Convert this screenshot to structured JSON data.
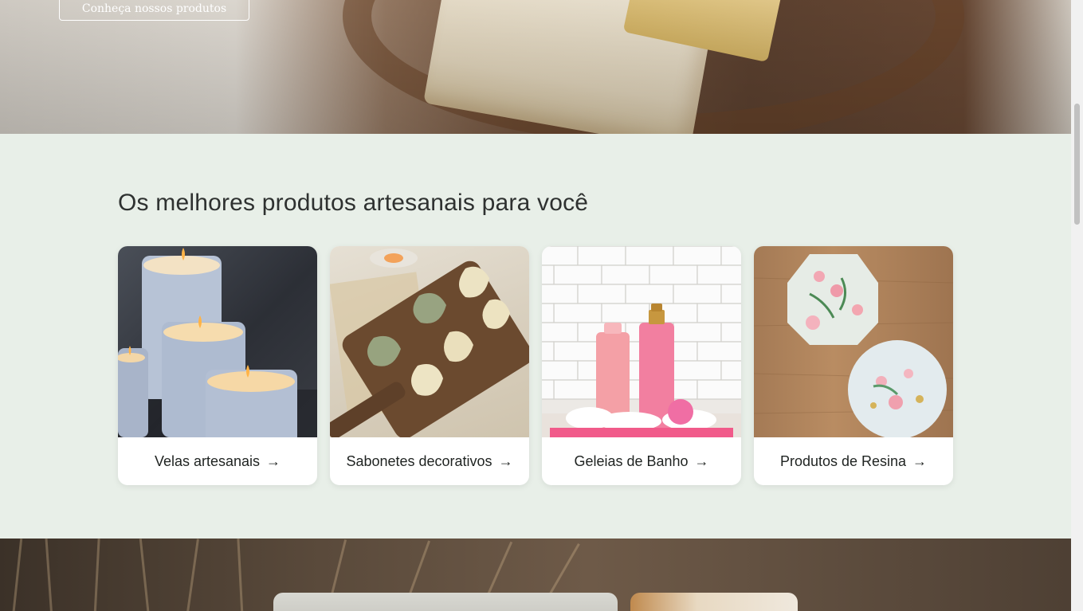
{
  "hero": {
    "button_label": "Conheça nossos produtos"
  },
  "products": {
    "title": "Os melhores produtos artesanais para você",
    "cards": [
      {
        "label": "Velas artesanais",
        "icon": "arrow-right-icon"
      },
      {
        "label": "Sabonetes decorativos",
        "icon": "arrow-right-icon"
      },
      {
        "label": "Geleias de Banho",
        "icon": "arrow-right-icon"
      },
      {
        "label": "Produtos de Resina",
        "icon": "arrow-right-icon"
      }
    ]
  },
  "icons": {
    "arrow": "→"
  },
  "colors": {
    "section_bg": "#e8efe8",
    "card_bg": "#ffffff",
    "text": "#1f2321"
  }
}
